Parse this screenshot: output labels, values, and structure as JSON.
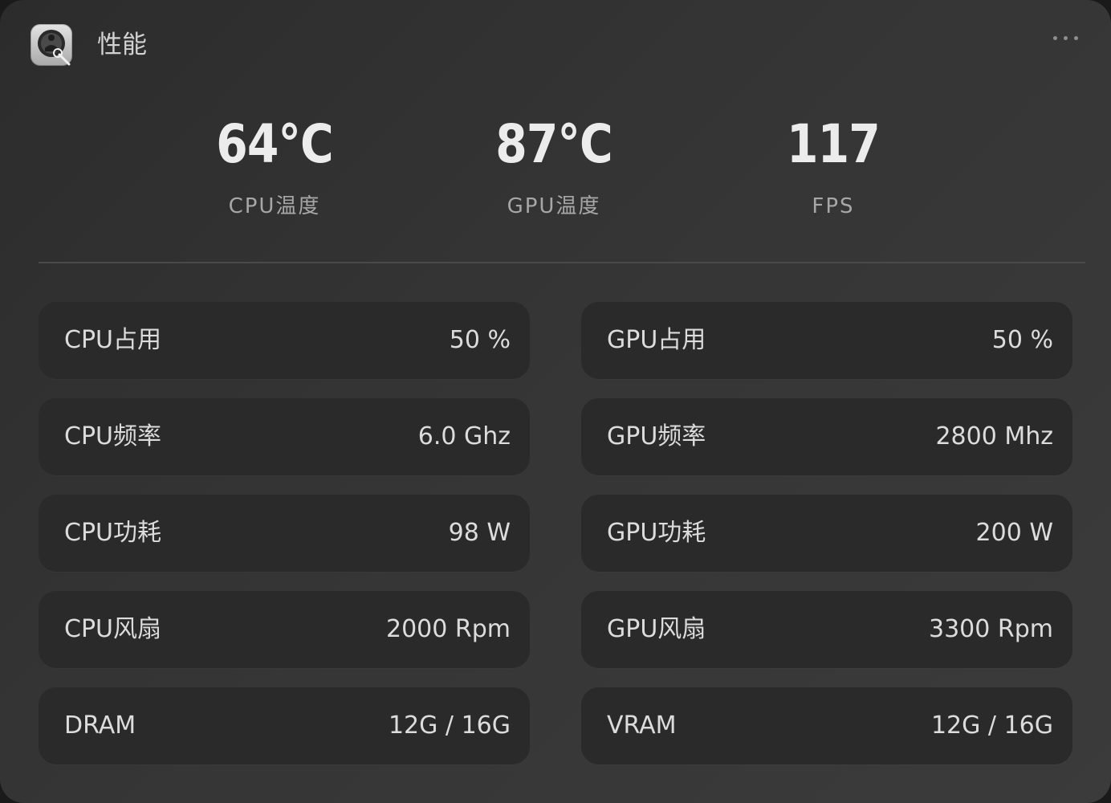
{
  "header": {
    "title": "性能",
    "more_icon": "more-horizontal-icon",
    "app_icon": "performance-monitor-icon"
  },
  "summary": [
    {
      "value": "64°C",
      "label": "CPU温度"
    },
    {
      "value": "87°C",
      "label": "GPU温度"
    },
    {
      "value": "117",
      "label": "FPS"
    }
  ],
  "metrics": {
    "cpu": [
      {
        "label": "CPU占用",
        "value": "50 %"
      },
      {
        "label": "CPU频率",
        "value": "6.0 Ghz"
      },
      {
        "label": "CPU功耗",
        "value": "98 W"
      },
      {
        "label": "CPU风扇",
        "value": "2000 Rpm"
      },
      {
        "label": "DRAM",
        "value": "12G / 16G"
      }
    ],
    "gpu": [
      {
        "label": "GPU占用",
        "value": "50 %"
      },
      {
        "label": "GPU频率",
        "value": "2800 Mhz"
      },
      {
        "label": "GPU功耗",
        "value": "200 W"
      },
      {
        "label": "GPU风扇",
        "value": "3300 Rpm"
      },
      {
        "label": "VRAM",
        "value": "12G / 16G"
      }
    ]
  },
  "colors": {
    "window_bg": "#333333",
    "card_bg": "#2a2a2a",
    "text_primary": "#dcdcdc",
    "text_secondary": "#a7a7a7",
    "divider": "#4a4a4a"
  }
}
